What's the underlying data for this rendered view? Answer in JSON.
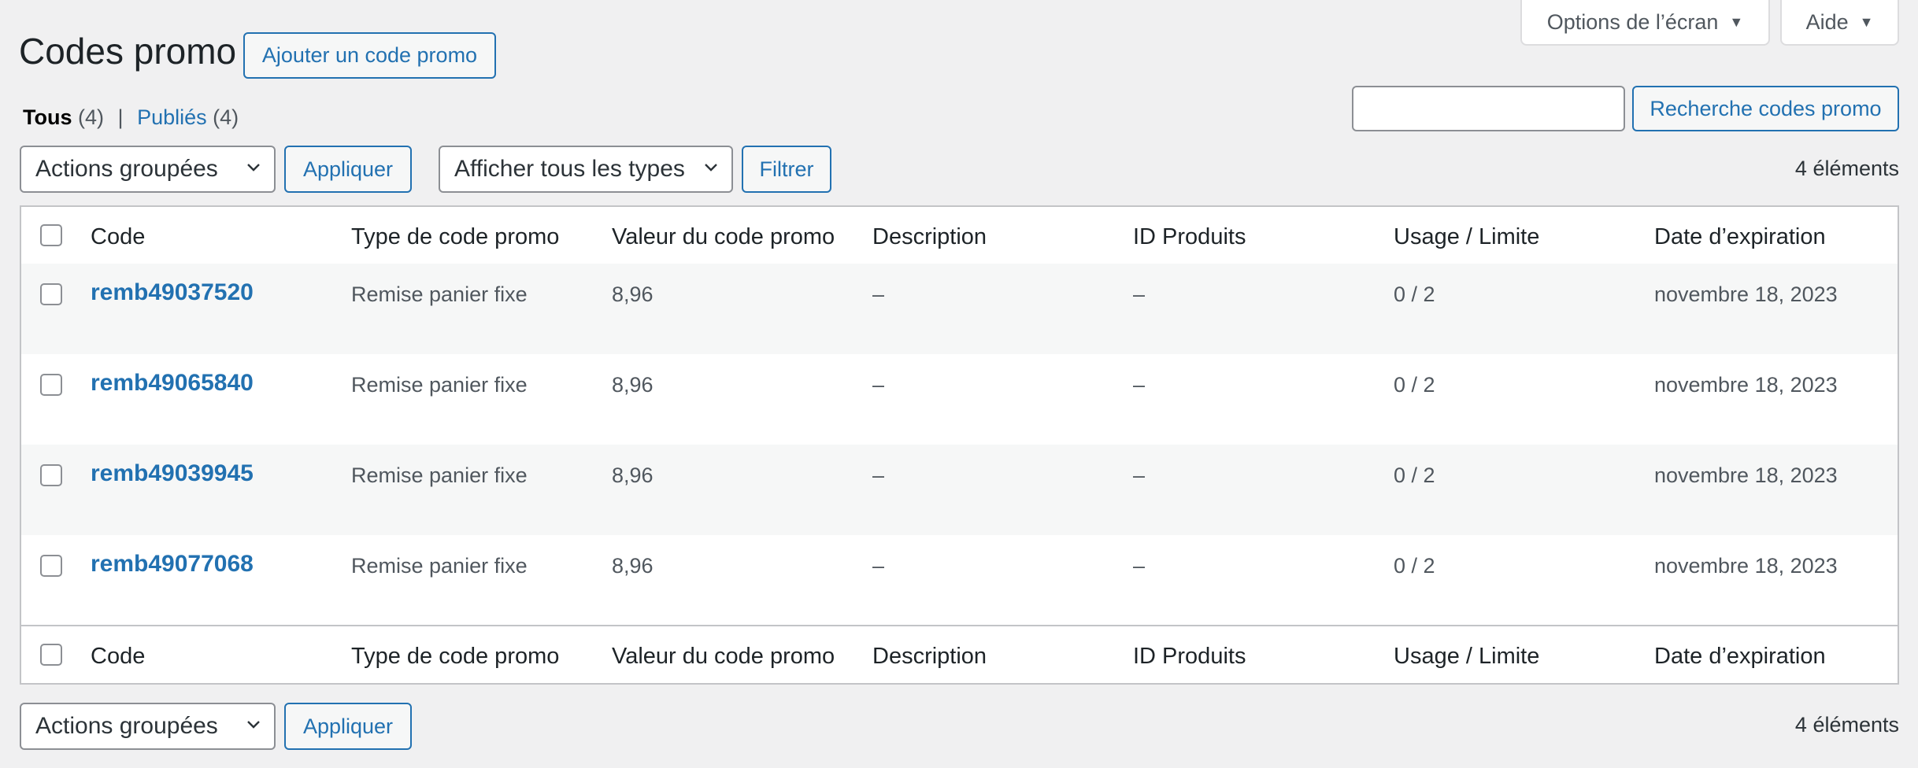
{
  "page": {
    "title": "Codes promo",
    "add_button": "Ajouter un code promo"
  },
  "screen_meta": {
    "options_label": "Options de l’écran",
    "help_label": "Aide"
  },
  "filters": {
    "all_label": "Tous",
    "all_count": "(4)",
    "separator": "|",
    "published_label": "Publiés",
    "published_count": "(4)"
  },
  "search": {
    "value": "",
    "button_label": "Recherche codes promo"
  },
  "top_nav": {
    "bulk_actions": "Actions groupées",
    "apply": "Appliquer",
    "type_filter": "Afficher tous les types",
    "filter_button": "Filtrer",
    "item_count": "4 éléments"
  },
  "bottom_nav": {
    "bulk_actions": "Actions groupées",
    "apply": "Appliquer",
    "item_count": "4 éléments"
  },
  "table": {
    "columns": [
      "Code",
      "Type de code promo",
      "Valeur du code promo",
      "Description",
      "ID Produits",
      "Usage / Limite",
      "Date d’expiration"
    ],
    "rows": [
      {
        "code": "remb49037520",
        "type": "Remise panier fixe",
        "value": "8,96",
        "description": "–",
        "product_ids": "–",
        "usage": "0 / 2",
        "expiry": "novembre 18, 2023"
      },
      {
        "code": "remb49065840",
        "type": "Remise panier fixe",
        "value": "8,96",
        "description": "–",
        "product_ids": "–",
        "usage": "0 / 2",
        "expiry": "novembre 18, 2023"
      },
      {
        "code": "remb49039945",
        "type": "Remise panier fixe",
        "value": "8,96",
        "description": "–",
        "product_ids": "–",
        "usage": "0 / 2",
        "expiry": "novembre 18, 2023"
      },
      {
        "code": "remb49077068",
        "type": "Remise panier fixe",
        "value": "8,96",
        "description": "–",
        "product_ids": "–",
        "usage": "0 / 2",
        "expiry": "novembre 18, 2023"
      }
    ]
  },
  "colors": {
    "accent": "#2271b1",
    "background": "#f0f0f1",
    "row_alt": "#f6f7f7",
    "border": "#c3c4c7"
  }
}
